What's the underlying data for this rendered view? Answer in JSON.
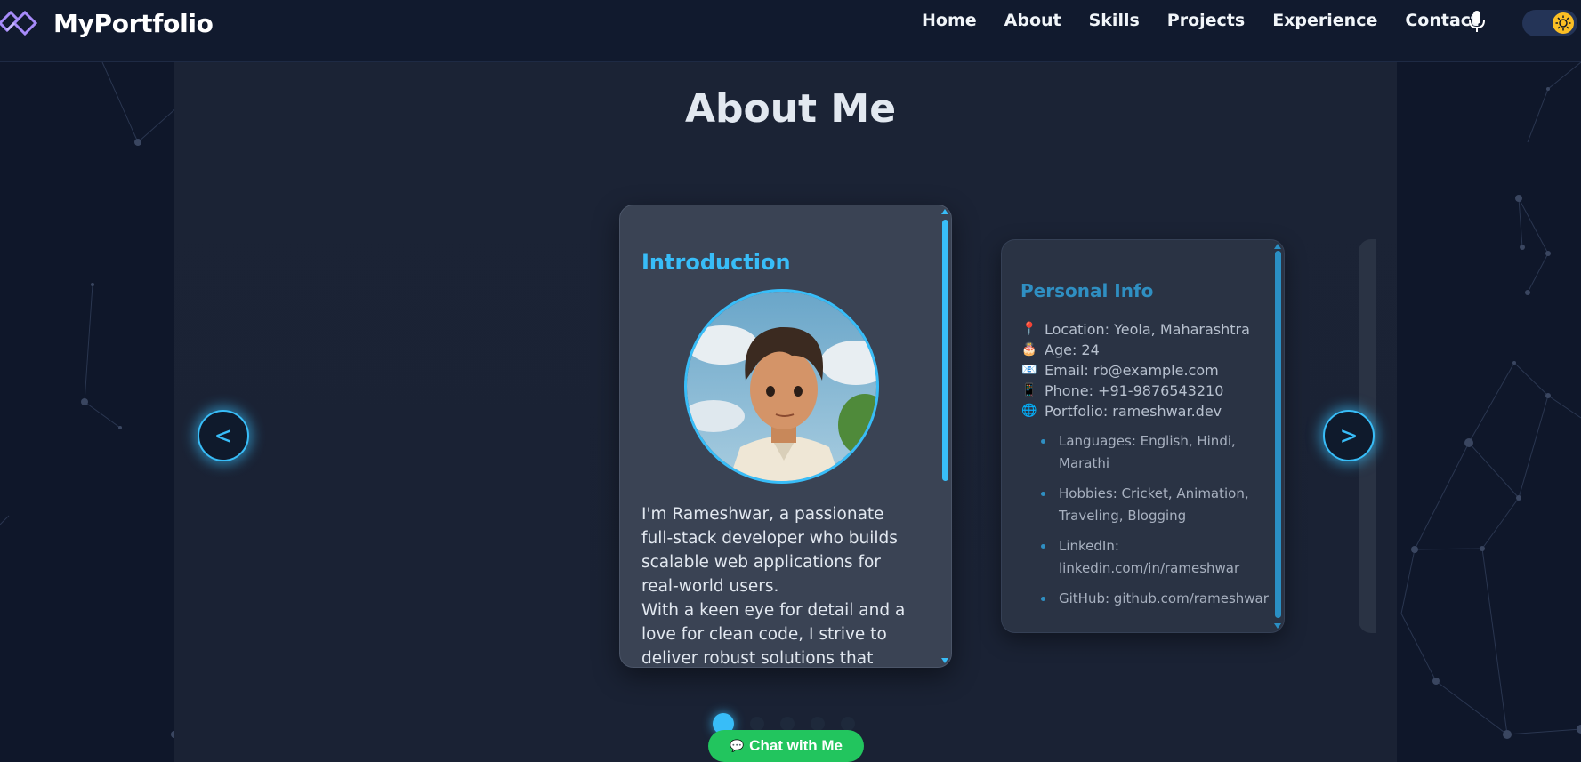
{
  "brand": {
    "name": "MyPortfolio"
  },
  "nav": {
    "links": [
      "Home",
      "About",
      "Skills",
      "Projects",
      "Experience",
      "Contact"
    ],
    "mic_icon": "microphone-icon",
    "theme_toggle_icon": "sun-icon"
  },
  "section": {
    "title": "About Me"
  },
  "carousel": {
    "prev_label": "<",
    "next_label": ">",
    "active_index": 0,
    "dot_count": 5
  },
  "intro_card": {
    "title": "Introduction",
    "avatar_alt": "avatar",
    "paragraphs": [
      "I'm Rameshwar, a passionate full-stack developer who builds scalable web applications for real-world users.",
      "With a keen eye for detail and a love for clean code, I strive to deliver robust solutions that make"
    ]
  },
  "personal_card": {
    "title": "Personal Info",
    "items": [
      {
        "icon": "pin-icon",
        "text": "Location: Yeola, Maharashtra"
      },
      {
        "icon": "cake-icon",
        "text": "Age: 24"
      },
      {
        "icon": "email-icon",
        "text": "Email: rb@example.com"
      },
      {
        "icon": "phone-icon",
        "text": "Phone: +91-9876543210"
      },
      {
        "icon": "globe-icon",
        "text": "Portfolio: rameshwar.dev"
      }
    ],
    "extras": [
      "Languages: English, Hindi, Marathi",
      "Hobbies: Cricket, Animation, Traveling, Blogging",
      "LinkedIn: linkedin.com/in/rameshwar",
      "GitHub: github.com/rameshwar"
    ]
  },
  "chat": {
    "label": "Chat with Me",
    "icon": "chat-bubble-icon"
  },
  "colors": {
    "accent": "#38bdf8",
    "chat_green": "#22c55e",
    "logo_purple": "#a78bfa",
    "background": "#0f172a"
  }
}
